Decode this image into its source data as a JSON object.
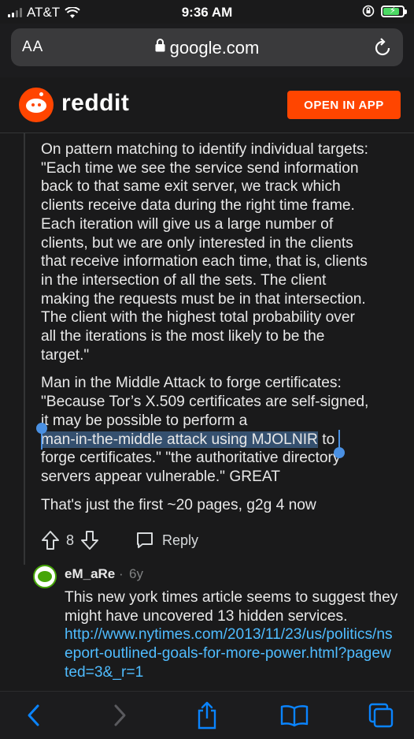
{
  "status_bar": {
    "carrier": "AT&T",
    "time": "9:36 AM"
  },
  "browser": {
    "aa_label": "AA",
    "url": "google.com"
  },
  "reddit_header": {
    "brand": "reddit",
    "open_in_app": "OPEN IN APP"
  },
  "comment": {
    "paragraph1_lines": [
      "On pattern matching to identify individual targets:",
      "\"Each time we see the service send information",
      "back to that same exit server, we track which",
      "clients receive data during the right time frame.",
      "Each iteration will give us a large number of",
      "clients, but we are only interested in the clients",
      "that receive information each time, that is, clients",
      "in the intersection of all the sets. The client",
      "making the requests must be in that intersection.",
      "The client with the highest total probability over",
      "all the iterations is the most likely to be the",
      "target.\""
    ],
    "paragraph2": {
      "line1": "Man in the Middle Attack to forge certificates:",
      "line2": "\"Because Tor’s X.509 certificates are self-signed,",
      "line3": "it may be possible to perform a",
      "line4_selected": "man-in-the-middle attack using MJOLNIR",
      "line4_rest": " to",
      "line5": "forge certificates.\" \"the authoritative directory",
      "line6": "servers appear vulnerable.\" GREAT"
    },
    "paragraph3": "That's just the first ~20 pages, g2g 4 now",
    "vote_count": "8",
    "reply_label": "Reply"
  },
  "child_comment": {
    "username": "eM_aRe",
    "separator": "·",
    "age": "6y",
    "lines": [
      "This new york times article seems to suggest they",
      "might have uncovered 13 hidden services."
    ],
    "link_lines": [
      "http://www.nytimes.com/2013/11/23/us/politics/ns",
      "eport-outlined-goals-for-more-power.html?pagew",
      "ted=3&_r=1"
    ]
  },
  "colors": {
    "reddit_orange": "#ff4500",
    "link_blue": "#4fbcff",
    "selection": "#35506f",
    "ios_blue": "#0a84ff",
    "battery_green": "#4cd964"
  },
  "icons": [
    "wifi-icon",
    "lock-icon",
    "reload-icon",
    "upvote-icon",
    "downvote-icon",
    "comment-icon",
    "back-icon",
    "forward-icon",
    "share-icon",
    "bookmarks-icon",
    "tabs-icon"
  ],
  "battery_level": 0.85
}
